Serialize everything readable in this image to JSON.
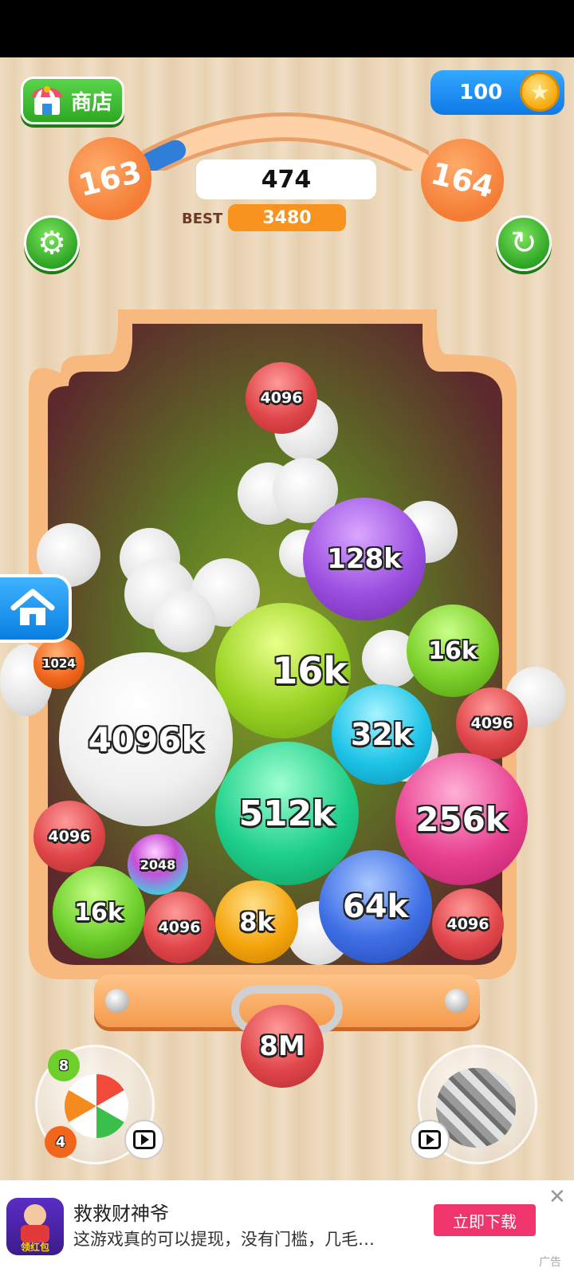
{
  "header": {
    "shop_label": "商店",
    "coins": "100",
    "level_current": "163",
    "level_next": "164",
    "score": "474",
    "best_label": "BEST",
    "best_score": "3480",
    "level_progress": 0.1
  },
  "balls": [
    {
      "label": "4096",
      "color": "#e0464a"
    },
    {
      "label": "128k",
      "color": "#9b4fe0"
    },
    {
      "label": "16k",
      "color": "#9ad323"
    },
    {
      "label": "16k",
      "color": "#7bd02a"
    },
    {
      "label": "1024",
      "color": "#f2661c"
    },
    {
      "label": "4096k",
      "color": "#f0f0f0"
    },
    {
      "label": "32k",
      "color": "#1ec4e8"
    },
    {
      "label": "4096",
      "color": "#e0464a"
    },
    {
      "label": "512k",
      "color": "#1fcf8a"
    },
    {
      "label": "256k",
      "color": "#e8408f"
    },
    {
      "label": "4096",
      "color": "#e0464a"
    },
    {
      "label": "2048",
      "color": "#c84fd8"
    },
    {
      "label": "16k",
      "color": "#6ccf2a"
    },
    {
      "label": "4096",
      "color": "#e0464a"
    },
    {
      "label": "8k",
      "color": "#f5a50c"
    },
    {
      "label": "64k",
      "color": "#3f6fe6"
    },
    {
      "label": "4096",
      "color": "#e0464a"
    }
  ],
  "next_ball": {
    "label": "8M",
    "color": "#e0464a"
  },
  "powerups": {
    "left_badge_top": "8",
    "left_badge_bottom": "4"
  },
  "ad": {
    "title": "救救财神爷",
    "description": "这游戏真的可以提现，没有门槛，几毛…",
    "cta": "立即下载",
    "tag": "广告",
    "close": "✕",
    "icon_text": "领红包"
  },
  "colors": {
    "accent_green": "#2ea823",
    "accent_orange": "#f47c34",
    "jar_interior": "#5c2a2c",
    "ad_button": "#f0356c"
  }
}
